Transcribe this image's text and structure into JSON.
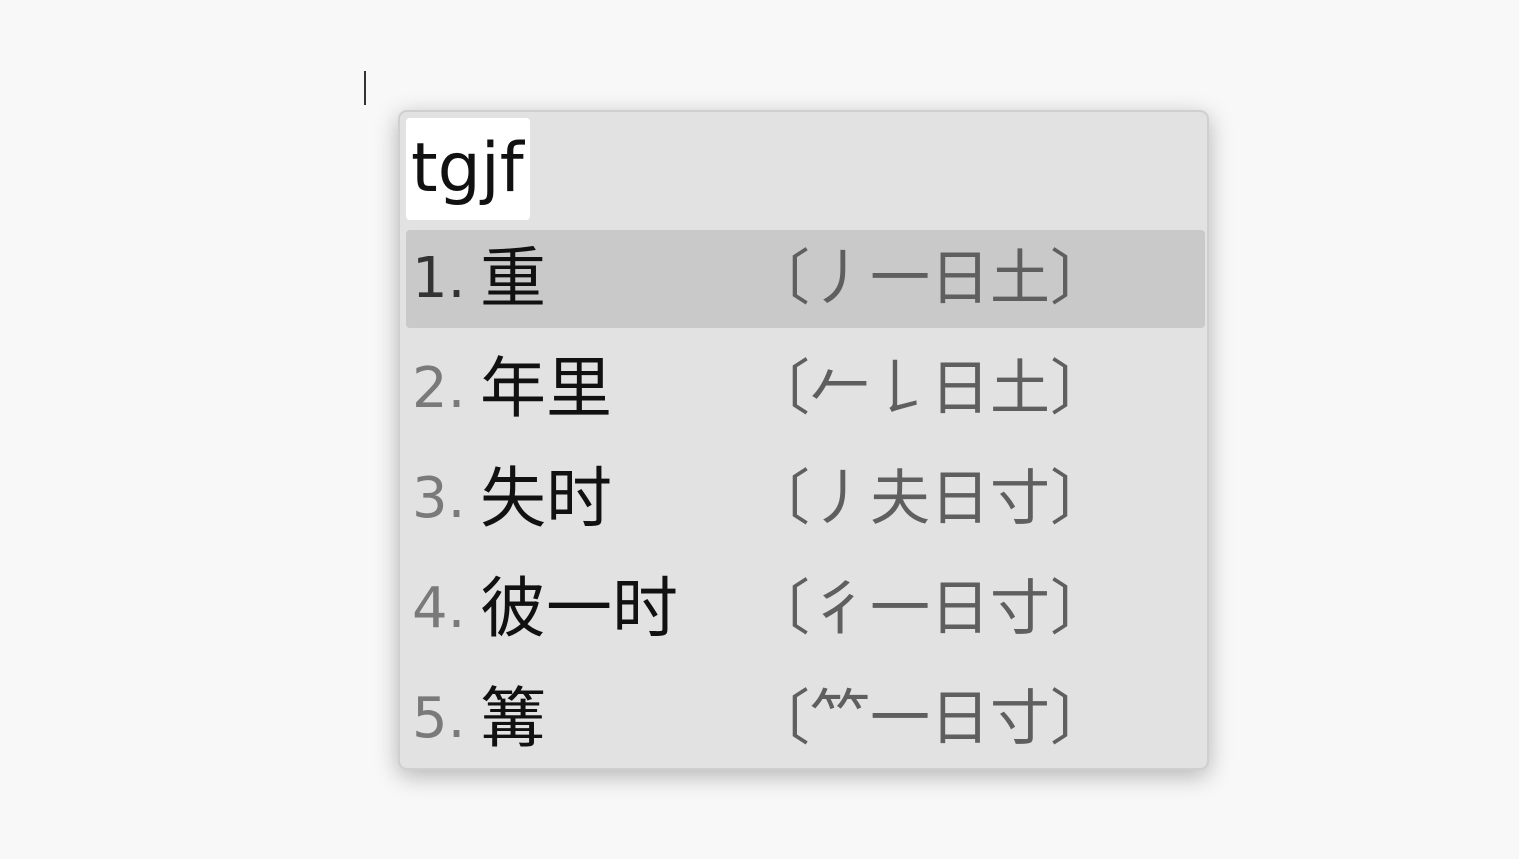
{
  "ime": {
    "input_code": "tgjf",
    "candidates": [
      {
        "index": "1.",
        "text": "重",
        "code": "〔丿一日土〕",
        "selected": true
      },
      {
        "index": "2.",
        "text": "年里",
        "code": "〔𠂉𠄌日土〕",
        "selected": false
      },
      {
        "index": "3.",
        "text": "失时",
        "code": "〔丿夫日寸〕",
        "selected": false
      },
      {
        "index": "4.",
        "text": "彼一时",
        "code": "〔彳一日寸〕",
        "selected": false
      },
      {
        "index": "5.",
        "text": "篝",
        "code": "〔⺮一日寸〕",
        "selected": false
      }
    ]
  },
  "colors": {
    "panel_bg": "#e2e2e2",
    "selected_bg": "#c9c9c9",
    "selected_index": "#333333",
    "normal_index": "#7a7a7a",
    "code_text": "#5f5f5f"
  }
}
